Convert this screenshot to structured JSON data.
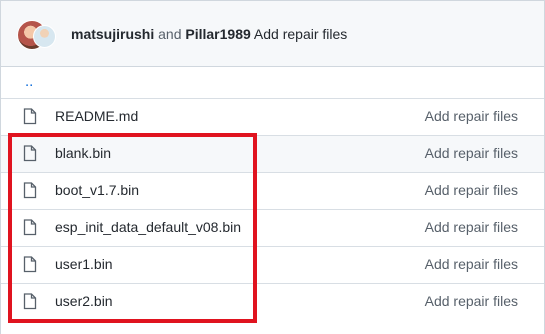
{
  "commit": {
    "author1": "matsujirushi",
    "conjunction": "and",
    "author2": "Pillar1989",
    "message": "Add repair files"
  },
  "parent_dir_label": "..",
  "files": [
    {
      "name": "README.md",
      "message": "Add repair files"
    },
    {
      "name": "blank.bin",
      "message": "Add repair files"
    },
    {
      "name": "boot_v1.7.bin",
      "message": "Add repair files"
    },
    {
      "name": "esp_init_data_default_v08.bin",
      "message": "Add repair files"
    },
    {
      "name": "user1.bin",
      "message": "Add repair files"
    },
    {
      "name": "user2.bin",
      "message": "Add repair files"
    }
  ],
  "icons": {
    "file": "file-icon"
  },
  "colors": {
    "highlight_box": "#e0131f",
    "link": "#0969da"
  }
}
